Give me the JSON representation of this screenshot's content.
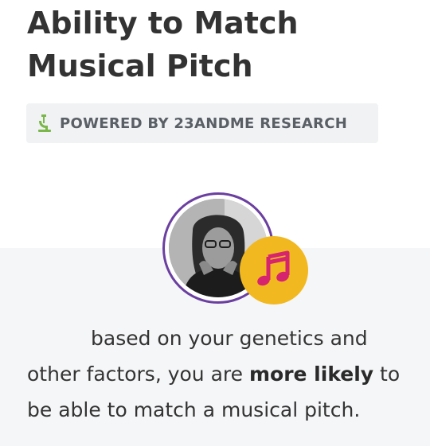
{
  "header": {
    "title_line1": "Ability to Match",
    "title_line2": "Musical Pitch"
  },
  "badge": {
    "icon": "microscope-icon",
    "label": "POWERED BY 23ANDME RESEARCH"
  },
  "result": {
    "avatar": "user-photo",
    "badge_icon": "music-note-icon",
    "text_part1": "based on your genetics and other factors, you are ",
    "text_emphasis": "more likely",
    "text_part2": " to be able to match a musical pitch."
  },
  "colors": {
    "ring": "#6b3fa0",
    "note_badge_bg": "#f2b820",
    "note_color": "#d6246e",
    "microscope": "#7ab648",
    "badge_bg": "#f0f2f4",
    "panel_bg": "#f5f6f8"
  }
}
